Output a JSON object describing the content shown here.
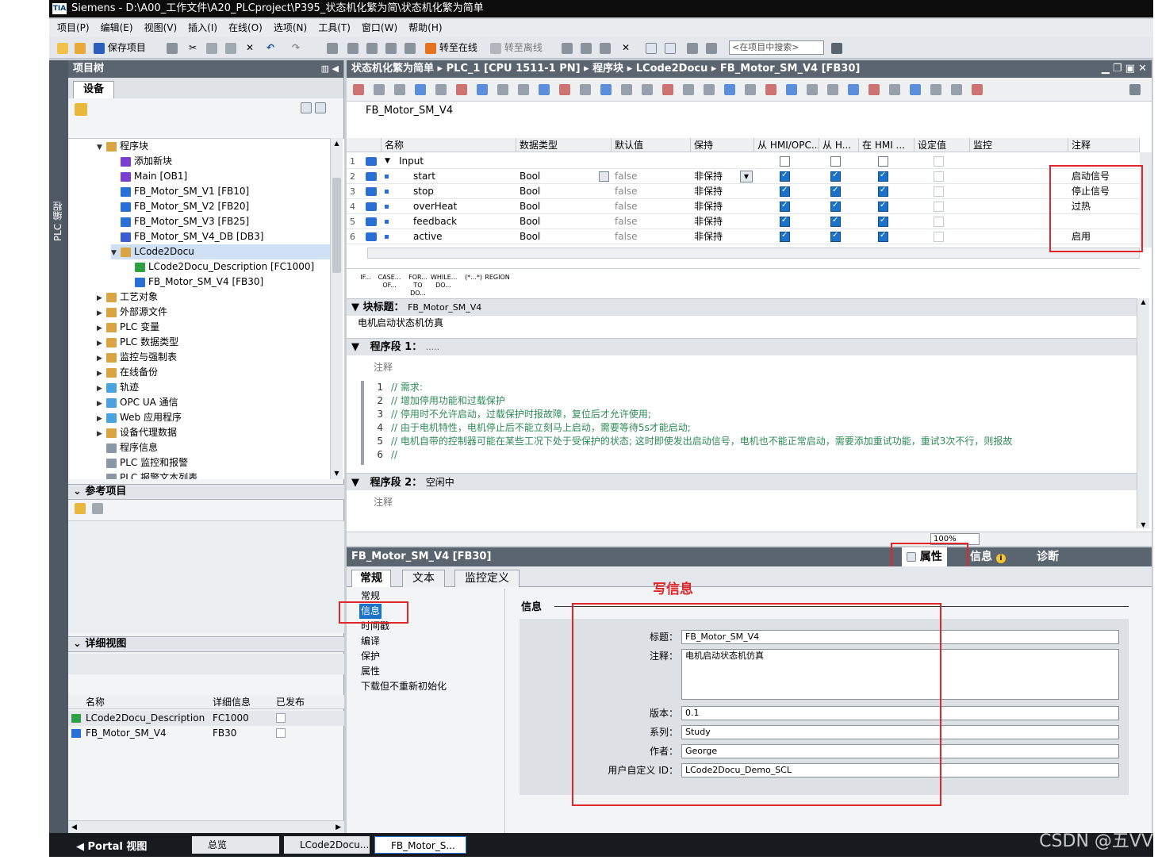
{
  "window": {
    "title": "Siemens  -  D:\\A00_工作文件\\A20_PLCproject\\P395_状态机化繁为简\\状态机化繁为简单",
    "logo": "TIA"
  },
  "menu": [
    "项目(P)",
    "编辑(E)",
    "视图(V)",
    "插入(I)",
    "在线(O)",
    "选项(N)",
    "工具(T)",
    "窗口(W)",
    "帮助(H)"
  ],
  "toolbar": {
    "save_label": "保存项目",
    "go_online": "转至在线",
    "go_offline": "转至离线",
    "search_placeholder": "<在项目中搜索>"
  },
  "leftstrip": {
    "label": "PLC 编程"
  },
  "project_tree": {
    "title": "项目树",
    "tab": "设备",
    "items": [
      {
        "label": "程序块",
        "level": 0,
        "expand": "▼",
        "color": "#d9a441"
      },
      {
        "label": "添加新块",
        "level": 1,
        "expand": "",
        "color": "#7b3fd0"
      },
      {
        "label": "Main [OB1]",
        "level": 1,
        "expand": "",
        "color": "#7b3fd0"
      },
      {
        "label": "FB_Motor_SM_V1 [FB10]",
        "level": 1,
        "expand": "",
        "color": "#2a6fd6"
      },
      {
        "label": "FB_Motor_SM_V2 [FB20]",
        "level": 1,
        "expand": "",
        "color": "#2a6fd6"
      },
      {
        "label": "FB_Motor_SM_V3 [FB25]",
        "level": 1,
        "expand": "",
        "color": "#2a6fd6"
      },
      {
        "label": "FB_Motor_SM_V4_DB [DB3]",
        "level": 1,
        "expand": "",
        "color": "#3b5fd0"
      },
      {
        "label": "LCode2Docu",
        "level": 1,
        "expand": "▼",
        "color": "#d9a441",
        "selected": true
      },
      {
        "label": "LCode2Docu_Description [FC1000]",
        "level": 2,
        "expand": "",
        "color": "#2ea043"
      },
      {
        "label": "FB_Motor_SM_V4 [FB30]",
        "level": 2,
        "expand": "",
        "color": "#2a6fd6"
      },
      {
        "label": "工艺对象",
        "level": 0,
        "expand": "▶",
        "color": "#d9a441"
      },
      {
        "label": "外部源文件",
        "level": 0,
        "expand": "▶",
        "color": "#d9a441"
      },
      {
        "label": "PLC 变量",
        "level": 0,
        "expand": "▶",
        "color": "#d9a441"
      },
      {
        "label": "PLC 数据类型",
        "level": 0,
        "expand": "▶",
        "color": "#d9a441"
      },
      {
        "label": "监控与强制表",
        "level": 0,
        "expand": "▶",
        "color": "#d9a441"
      },
      {
        "label": "在线备份",
        "level": 0,
        "expand": "▶",
        "color": "#d9a441"
      },
      {
        "label": "轨迹",
        "level": 0,
        "expand": "▶",
        "color": "#4aa3df"
      },
      {
        "label": "OPC UA 通信",
        "level": 0,
        "expand": "▶",
        "color": "#4aa3df"
      },
      {
        "label": "Web 应用程序",
        "level": 0,
        "expand": "▶",
        "color": "#4aa3df"
      },
      {
        "label": "设备代理数据",
        "level": 0,
        "expand": "▶",
        "color": "#d9a441"
      },
      {
        "label": "程序信息",
        "level": 0,
        "expand": "",
        "color": "#8a97a6"
      },
      {
        "label": "PLC 监控和报警",
        "level": 0,
        "expand": "",
        "color": "#8a97a6"
      },
      {
        "label": "PLC 报警文本列表",
        "level": 0,
        "expand": "",
        "color": "#8a97a6"
      }
    ]
  },
  "reference": {
    "title": "参考项目"
  },
  "detail_view": {
    "title": "详细视图",
    "headers": [
      "名称",
      "详细信息",
      "已发布"
    ],
    "rows": [
      {
        "name": "LCode2Docu_Description",
        "info": "FC1000",
        "color": "#2ea043"
      },
      {
        "name": "FB_Motor_SM_V4",
        "info": "FB30",
        "color": "#2a6fd6"
      }
    ]
  },
  "editor": {
    "breadcrumb": "状态机化繁为简单  ▸  PLC_1 [CPU 1511-1 PN]  ▸  程序块  ▸  LCode2Docu  ▸  FB_Motor_SM_V4 [FB30]",
    "block_name": "FB_Motor_SM_V4",
    "columns": [
      "名称",
      "数据类型",
      "默认值",
      "保持",
      "从 HMI/OPC...",
      "从 H...",
      "在 HMI ...",
      "设定值",
      "监控",
      "注释"
    ],
    "section": "Input",
    "rows": [
      {
        "num": "1",
        "name": "Input",
        "type": "",
        "default": "",
        "retain": "",
        "hmi1": false,
        "hmi2": false,
        "hmi3": false,
        "comment": ""
      },
      {
        "num": "2",
        "name": "start",
        "type": "Bool",
        "default": "false",
        "retain": "非保持",
        "hmi1": true,
        "hmi2": true,
        "hmi3": true,
        "comment": "启动信号"
      },
      {
        "num": "3",
        "name": "stop",
        "type": "Bool",
        "default": "false",
        "retain": "非保持",
        "hmi1": true,
        "hmi2": true,
        "hmi3": true,
        "comment": "停止信号"
      },
      {
        "num": "4",
        "name": "overHeat",
        "type": "Bool",
        "default": "false",
        "retain": "非保持",
        "hmi1": true,
        "hmi2": true,
        "hmi3": true,
        "comment": "过热"
      },
      {
        "num": "5",
        "name": "feedback",
        "type": "Bool",
        "default": "false",
        "retain": "非保持",
        "hmi1": true,
        "hmi2": true,
        "hmi3": true,
        "comment": ""
      },
      {
        "num": "6",
        "name": "active",
        "type": "Bool",
        "default": "false",
        "retain": "非保持",
        "hmi1": true,
        "hmi2": true,
        "hmi3": true,
        "comment": "启用"
      }
    ],
    "keywords": [
      "IF...",
      "CASE... OF...",
      "FOR... TO DO...",
      "WHILE... DO...",
      "(*...*)",
      "REGION"
    ],
    "block_title_label": "块标题：",
    "block_title_value": "FB_Motor_SM_V4",
    "block_comment": "电机启动状态机仿真",
    "network1": {
      "label": "程序段 1：",
      "value": "....."
    },
    "comment_placeholder": "注释",
    "code": [
      {
        "n": "1",
        "text": "// 需求:"
      },
      {
        "n": "2",
        "text": "// 增加停用功能和过载保护"
      },
      {
        "n": "3",
        "text": "// 停用时不允许启动，过载保护时报故障，复位后才允许使用;"
      },
      {
        "n": "4",
        "text": "// 由于电机特性，电机停止后不能立刻马上启动，需要等待5s才能启动;"
      },
      {
        "n": "5",
        "text": "// 电机自带的控制器可能在某些工况下处于受保护的状态; 这时即使发出启动信号，电机也不能正常启动，需要添加重试功能，重试3次不行，则报故"
      },
      {
        "n": "6",
        "text": "//"
      }
    ],
    "network2": {
      "label": "程序段 2：",
      "value": "空闲中"
    },
    "zoom": "100%"
  },
  "properties": {
    "title": "FB_Motor_SM_V4 [FB30]",
    "right_tabs": [
      "属性",
      "信息",
      "诊断"
    ],
    "tabs": [
      "常规",
      "文本",
      "监控定义"
    ],
    "annotation": "写信息",
    "nav": [
      "常规",
      "信息",
      "时间戳",
      "编译",
      "保护",
      "属性",
      "下载但不重新初始化"
    ],
    "section": "信息",
    "fields": {
      "title_label": "标题：",
      "title_value": "FB_Motor_SM_V4",
      "comment_label": "注释：",
      "comment_value": "电机启动状态机仿真",
      "version_label": "版本：",
      "version_value": "0.1",
      "family_label": "系列：",
      "family_value": "Study",
      "author_label": "作者：",
      "author_value": "George",
      "userid_label": "用户自定义 ID：",
      "userid_value": "LCode2Docu_Demo_SCL"
    }
  },
  "statusbar": {
    "portal": "Portal 视图",
    "tabs": [
      "总览",
      "LCode2Docu...",
      "FB_Motor_S..."
    ]
  },
  "watermark": "CSDN @五VV"
}
